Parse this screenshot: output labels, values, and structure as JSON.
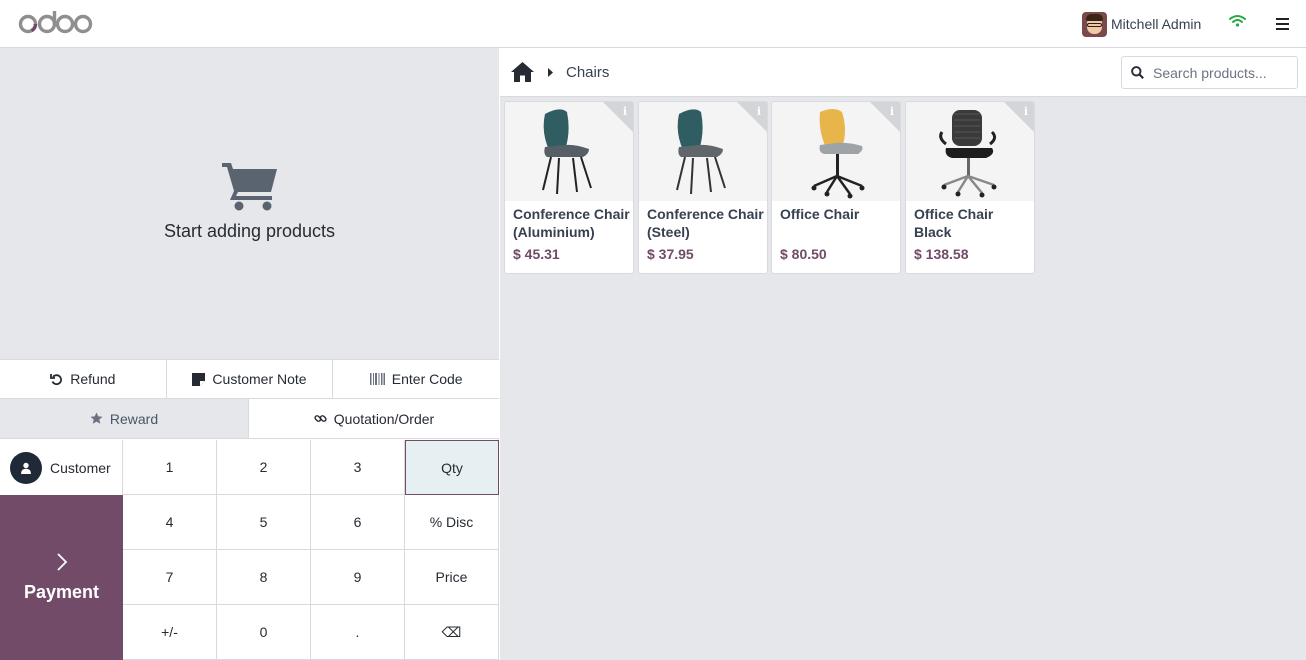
{
  "header": {
    "logo_text": "odoo",
    "user_name": "Mitchell Admin",
    "icons": [
      "avatar",
      "wifi-icon",
      "hamburger-menu-icon"
    ]
  },
  "order": {
    "empty_message": "Start adding products"
  },
  "controls": {
    "refund": "Refund",
    "customer_note": "Customer Note",
    "enter_code": "Enter Code",
    "reward": "Reward",
    "quotation_order": "Quotation/Order"
  },
  "actionpad": {
    "customer": "Customer",
    "payment": "Payment"
  },
  "numpad": {
    "keys": [
      "1",
      "2",
      "3",
      "Qty",
      "4",
      "5",
      "6",
      "% Disc",
      "7",
      "8",
      "9",
      "Price",
      "+/-",
      "0",
      ".",
      "⌫"
    ],
    "active_mode": "Qty"
  },
  "breadcrumb": {
    "category": "Chairs"
  },
  "search": {
    "placeholder": "Search products..."
  },
  "products": [
    {
      "name": "Conference Chair (Aluminium)",
      "price": "$ 45.31"
    },
    {
      "name": "Conference Chair (Steel)",
      "price": "$ 37.95"
    },
    {
      "name": "Office Chair",
      "price": "$ 80.50"
    },
    {
      "name": "Office Chair Black",
      "price": "$ 138.58"
    }
  ],
  "colors": {
    "brand": "#714b67",
    "background_gray": "#e6e7eb",
    "wifi_green": "#28a745"
  }
}
